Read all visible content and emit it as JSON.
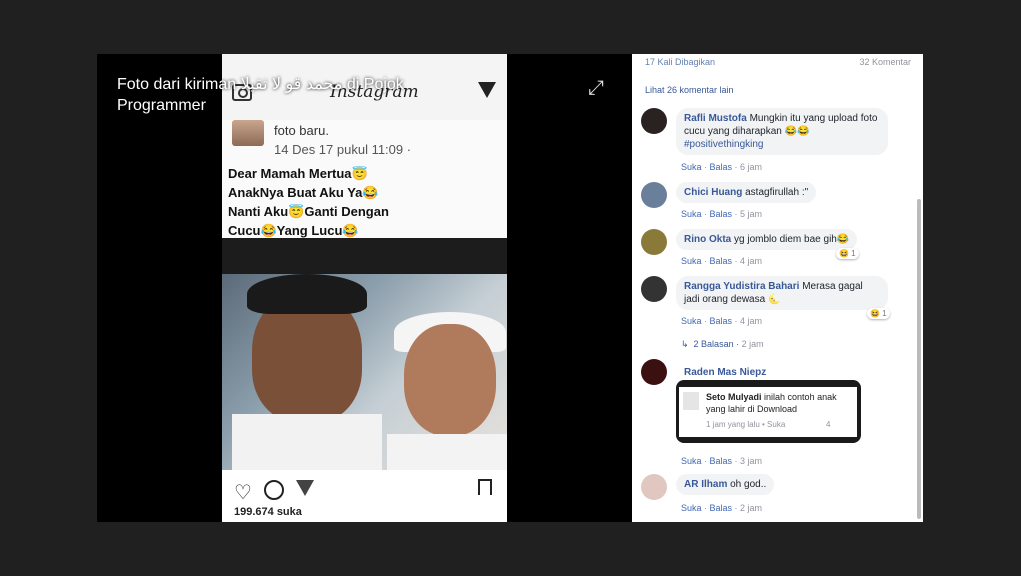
{
  "photo": {
    "caption": "Foto dari kiriman محمد قو لا ثقيلا di Pojok Programmer",
    "expand_icon": "expand-icon",
    "instagram": {
      "logo": "Instagram",
      "post_line": "foto baru.",
      "post_date": "14 Des 17 pukul 11:09 ·",
      "lines": [
        "Dear Mamah Mertua😇",
        "AnakNya Buat Aku Ya😂",
        "Nanti Aku😇Ganti Dengan",
        "Cucu😂Yang Lucu😂"
      ],
      "likes": "199.674 suka"
    }
  },
  "comments_panel": {
    "shares": "17 Kali Dibagikan",
    "comment_count": "32 Komentar",
    "more_comments": "Lihat 26 komentar lain",
    "action_like": "Suka",
    "action_reply": "Balas",
    "comments": [
      {
        "name": "Rafli Mustofa",
        "text": "Mungkin itu yang upload foto cucu yang diharapkan 😂😂",
        "tag": "#positivethingking",
        "time": "6 jam",
        "avatar_color": "#2a2220"
      },
      {
        "name": "Chici Huang",
        "text": "astagfirullah :\"",
        "time": "5 jam",
        "avatar_color": "#6a7f9a"
      },
      {
        "name": "Rino Okta",
        "text": "yg jomblo diem bae gih😂",
        "time": "4 jam",
        "reaction": "😆 1",
        "avatar_color": "#8a7a3a"
      },
      {
        "name": "Rangga Yudistira Bahari",
        "text": "Merasa gagal jadi orang dewasa 🌜",
        "time": "4 jam",
        "reaction": "😆 1",
        "avatar_color": "#333"
      },
      {
        "name": "Raden Mas Niepz",
        "text": "",
        "time": "3 jam",
        "avatar_color": "#3a1010"
      },
      {
        "name": "AR Ilham",
        "text": "oh god..",
        "time": "2 jam",
        "avatar_color": "#e0c8c0"
      }
    ],
    "replies": {
      "label": "2 Balasan",
      "time": "2 jam"
    },
    "embed": {
      "name": "Seto Mulyadi",
      "text": "inilah contoh anak yang lahir di Download",
      "meta": "1 jam yang lalu • Suka",
      "count": "4"
    }
  }
}
